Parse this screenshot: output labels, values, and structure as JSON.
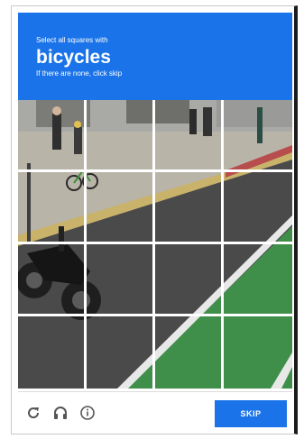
{
  "header": {
    "instruction": "Select all squares with",
    "target": "bicycles",
    "hint": "If there are none, click skip"
  },
  "grid": {
    "rows": 4,
    "cols": 4
  },
  "footer": {
    "reload_icon": "reload-icon",
    "audio_icon": "headphones-icon",
    "info_icon": "info-icon",
    "skip_label": "SKIP"
  },
  "colors": {
    "accent": "#1a73e8",
    "bike_lane": "#3f8f4a",
    "road": "#4a4a4a"
  }
}
